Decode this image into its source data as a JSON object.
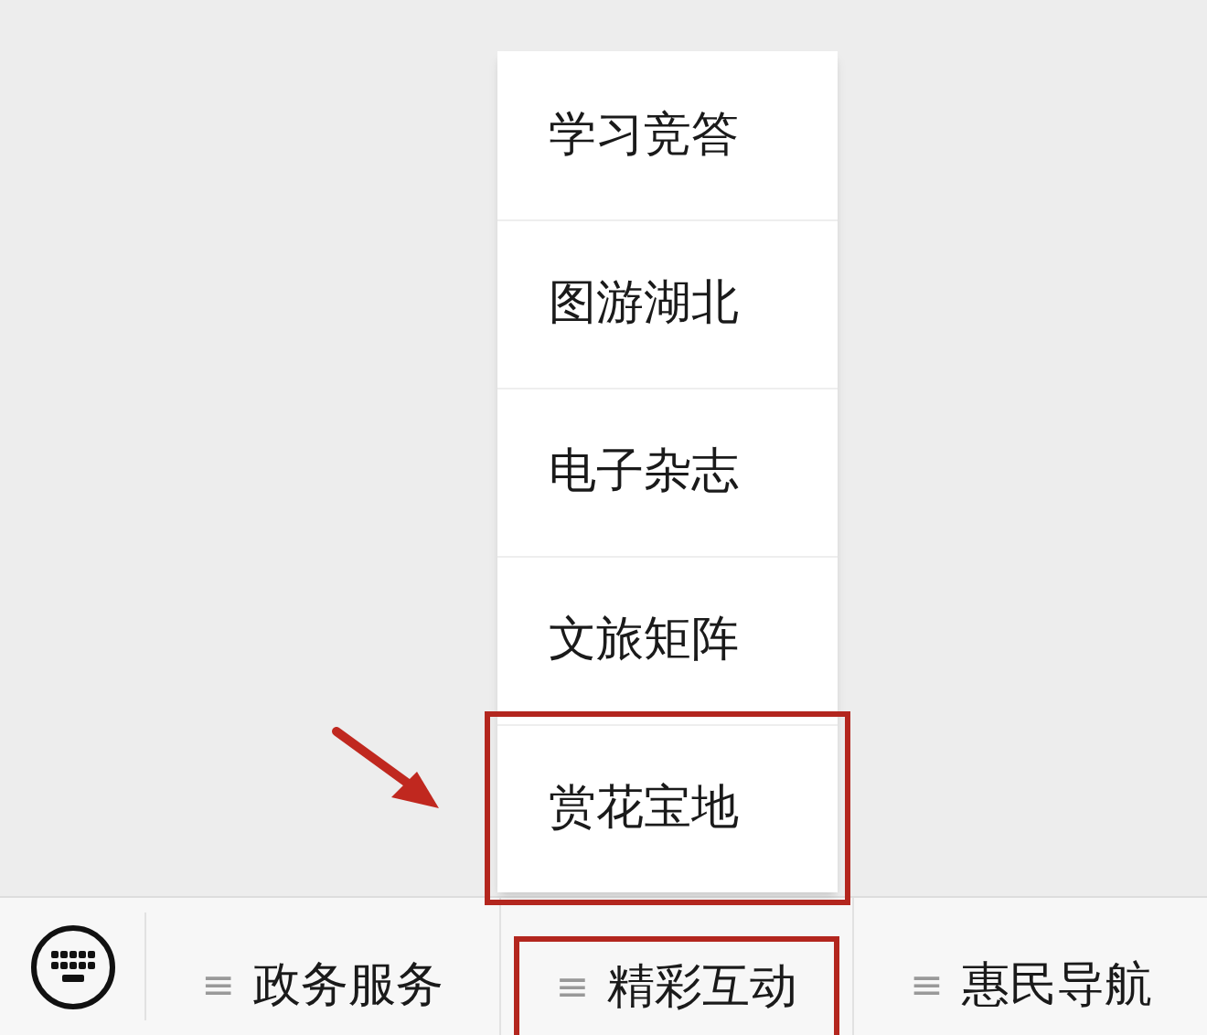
{
  "submenu": {
    "items": [
      {
        "label": "学习竞答",
        "annotated": false
      },
      {
        "label": "图游湖北",
        "annotated": false
      },
      {
        "label": "电子杂志",
        "annotated": false
      },
      {
        "label": "文旅矩阵",
        "annotated": false
      },
      {
        "label": "赏花宝地",
        "annotated": true
      }
    ]
  },
  "bottom_menu": [
    {
      "icon": "≡",
      "label": "政务服务",
      "annotated": false
    },
    {
      "icon": "≡",
      "label": "精彩互动",
      "annotated": true
    },
    {
      "icon": "≡",
      "label": "惠民导航",
      "annotated": false
    }
  ]
}
